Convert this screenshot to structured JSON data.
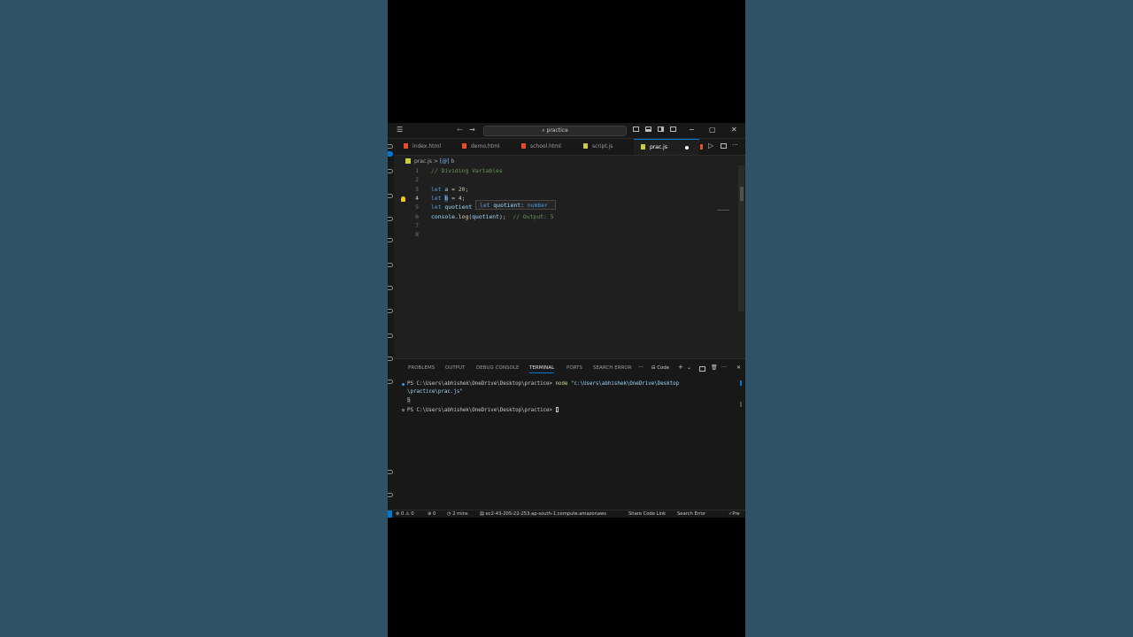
{
  "window": {
    "search_text": "practice"
  },
  "tabs": [
    {
      "label": "index.html",
      "type": "html"
    },
    {
      "label": "demo.html",
      "type": "html"
    },
    {
      "label": "school.html",
      "type": "html"
    },
    {
      "label": "script.js",
      "type": "js"
    },
    {
      "label": "prac.js",
      "type": "js",
      "active": true,
      "modified": true
    }
  ],
  "breadcrumb": {
    "file": "prac.js",
    "separator": ">",
    "symbol": "b"
  },
  "editor": {
    "line_numbers": [
      "1",
      "2",
      "3",
      "4",
      "5",
      "6",
      "7",
      "8"
    ],
    "current_line": "4",
    "lines": {
      "l1_comment": "// Dividing Variables",
      "l3_kw": "let",
      "l3_var": "a",
      "l3_eq": " = ",
      "l3_num": "20",
      "l3_end": ";",
      "l4_kw": "let",
      "l4_var": "b",
      "l4_eq": " = ",
      "l4_num": "4",
      "l4_end": ";",
      "l5_kw": "let",
      "l5_var": "quotient",
      "l6_obj": "console",
      "l6_dot": ".",
      "l6_fn": "log",
      "l6_open": "(",
      "l6_arg": "quotient",
      "l6_close": ");",
      "l6_comment": "// Output: 5"
    },
    "hover": {
      "kw": "let",
      "name": "quotient",
      "sep": ": ",
      "type": "number"
    }
  },
  "panel": {
    "tabs": [
      "PROBLEMS",
      "OUTPUT",
      "DEBUG CONSOLE",
      "TERMINAL",
      "PORTS",
      "SEARCH ERROR"
    ],
    "active_tab": "TERMINAL",
    "more": "···",
    "shell": "Code",
    "terminal": {
      "line1_prompt": "PS C:\\Users\\abhishek\\OneDrive\\Desktop\\practice> ",
      "line1_cmd": "node ",
      "line1_arg": "\"c:\\Users\\abhishek\\OneDrive\\Desktop",
      "line2_arg": "\\practice\\prac.js\"",
      "output": "5",
      "line3_prompt": "PS C:\\Users\\abhishek\\OneDrive\\Desktop\\practice> "
    }
  },
  "statusbar": {
    "errors": "0",
    "warnings": "0",
    "ports": "0",
    "time": "2 mins",
    "remote": "ec2-43-205-22-253.ap-south-1.compute.amazonaws",
    "share": "Share Code Link",
    "search_error": "Search Error",
    "prettier": "Pre"
  },
  "colors": {
    "background": "#2f5366",
    "editor_bg": "#1f1f1f",
    "accent": "#0078d4",
    "html_icon": "#e44d26",
    "js_icon": "#cbcb41"
  }
}
